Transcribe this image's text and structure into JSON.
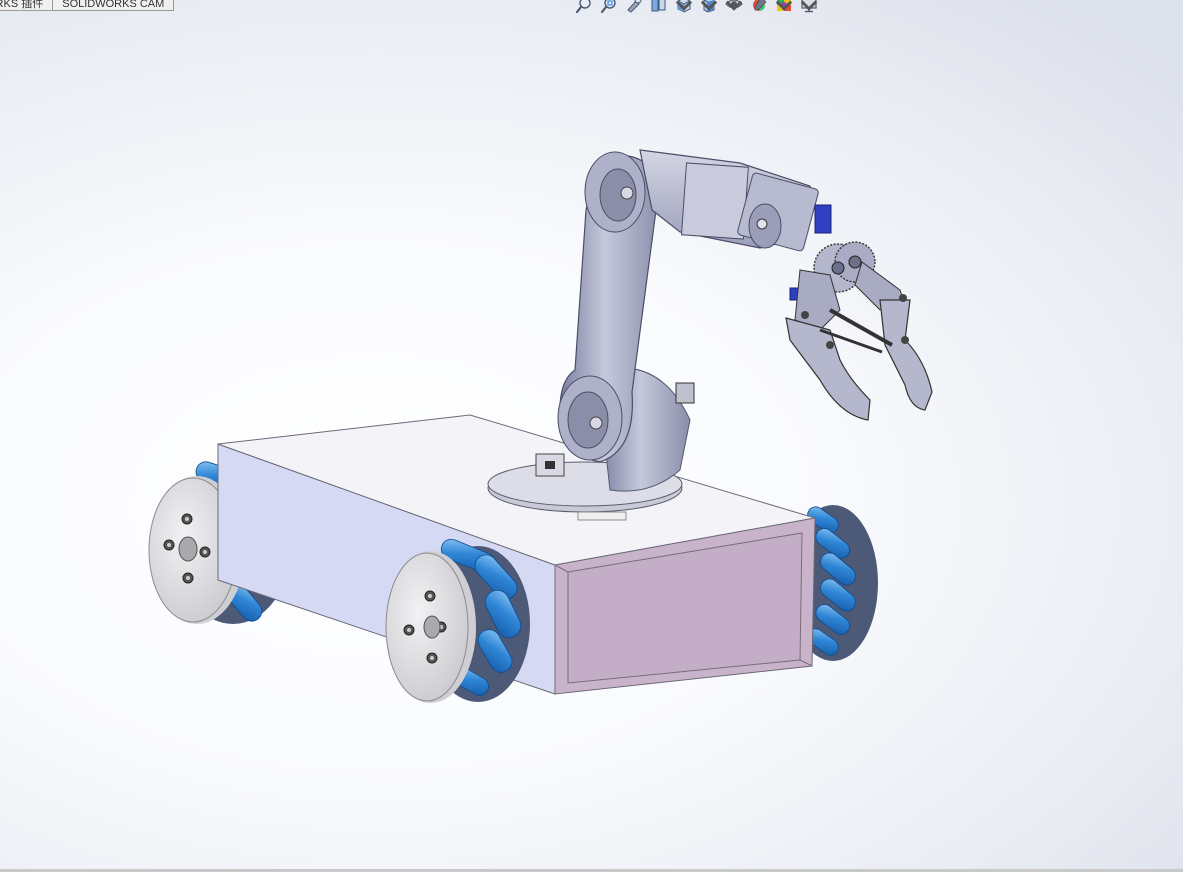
{
  "tabs": [
    {
      "label": "ORKS 插件"
    },
    {
      "label": "SOLIDWORKS CAM"
    }
  ],
  "toolbar": {
    "tools": [
      {
        "icon": "zoom-to-fit-icon",
        "has_menu": false
      },
      {
        "icon": "zoom-to-area-icon",
        "has_menu": false
      },
      {
        "icon": "previous-view-icon",
        "has_menu": false
      },
      {
        "icon": "section-view-icon",
        "has_menu": false
      },
      {
        "icon": "view-orientation-icon",
        "has_menu": true
      },
      {
        "icon": "display-style-icon",
        "has_menu": true
      },
      {
        "icon": "hide-show-items-icon",
        "has_menu": true
      },
      {
        "icon": "edit-appearance-icon",
        "has_menu": false
      },
      {
        "icon": "apply-scene-icon",
        "has_menu": true
      },
      {
        "icon": "view-settings-icon",
        "has_menu": true
      }
    ]
  },
  "model": {
    "name": "mecanum-chassis-with-robotic-arm",
    "colors": {
      "chassis_top": "#f4f4f8",
      "chassis_side": "#d9dcf4",
      "chassis_front": "#c9b3cb",
      "chassis_front_panel": "#c4aec7",
      "roller_blue": "#2f86d6",
      "roller_highlight": "#8cc6f4",
      "hub_gray": "#dcdcde",
      "arm_metal": "#9a9eb6",
      "arm_light": "#c7cadc",
      "servo_blue": "#3040c0"
    }
  }
}
